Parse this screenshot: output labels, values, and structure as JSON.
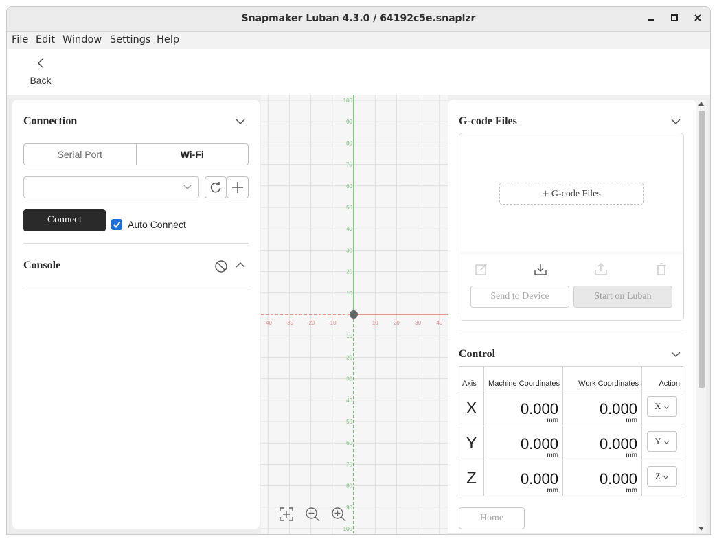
{
  "window": {
    "title": "Snapmaker Luban 4.3.0 / 64192c5e.snaplzr",
    "minimize_label": "–",
    "maximize_label": "□",
    "close_label": "✕"
  },
  "menu": [
    "File",
    "Edit",
    "Window",
    "Settings",
    "Help"
  ],
  "topbar": {
    "back_label": "Back"
  },
  "connection": {
    "title": "Connection",
    "tabs": [
      "Serial Port",
      "Wi-Fi"
    ],
    "active_tab": "Wi-Fi",
    "device_select_value": "",
    "connect_label": "Connect",
    "auto_connect_label": "Auto Connect",
    "auto_connect_checked": true
  },
  "console": {
    "title": "Console"
  },
  "canvas": {
    "y_ticks": [
      "100",
      "90",
      "80",
      "70",
      "60",
      "50",
      "40",
      "30",
      "20",
      "10",
      "10",
      "20",
      "30",
      "40",
      "50",
      "60",
      "70",
      "80",
      "90",
      "100"
    ],
    "x_ticks_neg": [
      "-40",
      "-30",
      "-20",
      "-10"
    ],
    "x_ticks_pos": [
      "10",
      "20",
      "30",
      "40"
    ]
  },
  "gcode": {
    "title": "G-code Files",
    "add_label": "G-code Files",
    "send_label": "Send to Device",
    "start_label": "Start on Luban"
  },
  "control": {
    "title": "Control",
    "headers": {
      "axis": "Axis",
      "machine": "Machine Coordinates",
      "work": "Work Coordinates",
      "action": "Action"
    },
    "rows": [
      {
        "axis": "X",
        "machine": "0.000",
        "work": "0.000",
        "unit": "mm",
        "action": "X"
      },
      {
        "axis": "Y",
        "machine": "0.000",
        "work": "0.000",
        "unit": "mm",
        "action": "Y"
      },
      {
        "axis": "Z",
        "machine": "0.000",
        "work": "0.000",
        "unit": "mm",
        "action": "Z"
      }
    ],
    "home_label": "Home"
  },
  "colors": {
    "accent": "#1e6fd9",
    "primary_button": "#2a2a2a",
    "x_axis": "#e05a5a",
    "y_axis": "#3aa03a"
  }
}
